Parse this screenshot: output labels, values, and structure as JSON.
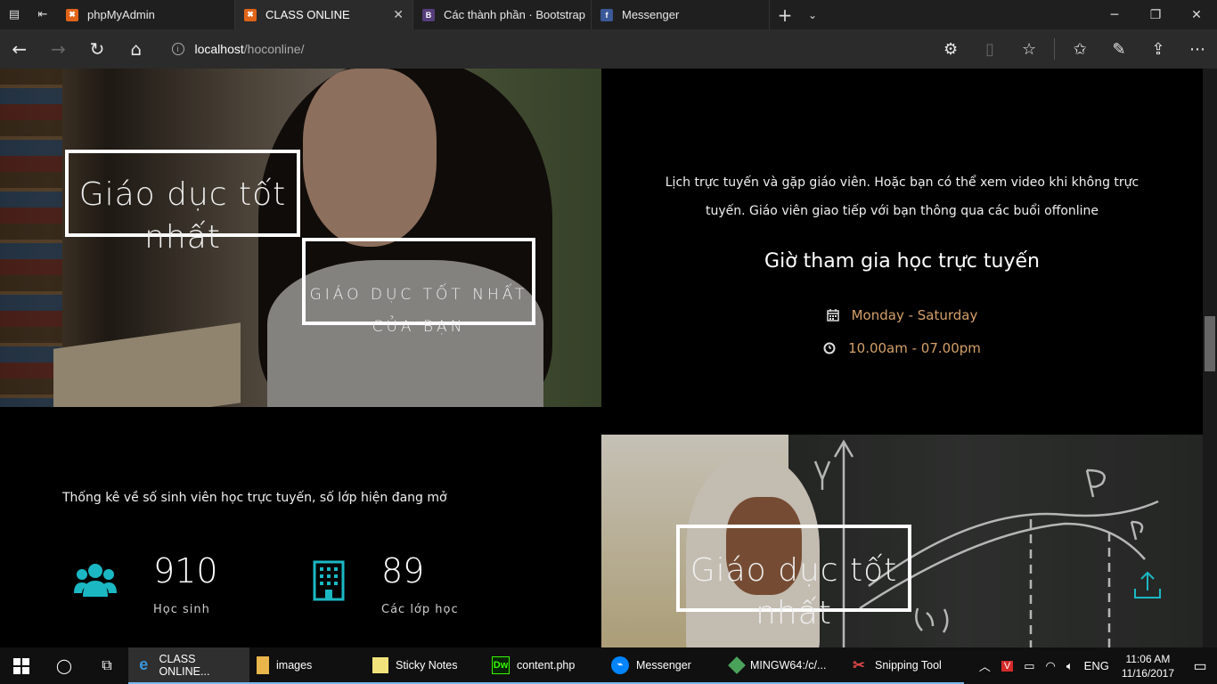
{
  "browser": {
    "tabs": [
      {
        "label": "phpMyAdmin",
        "favicon": "xampp-icon",
        "active": false
      },
      {
        "label": "CLASS ONLINE",
        "favicon": "xampp-icon",
        "active": true
      },
      {
        "label": "Các thành phần · Bootstrap",
        "favicon": "bootstrap-icon",
        "active": false
      },
      {
        "label": "Messenger",
        "favicon": "facebook-icon",
        "active": false
      }
    ],
    "address": {
      "host": "localhost",
      "path": "/hoconline/"
    },
    "colors": {
      "titlebar": "#1f1f1f",
      "toolbar": "#2b2b2b",
      "xampp": "#e06418",
      "bootstrap": "#563d7c",
      "facebook": "#3b5998"
    }
  },
  "page": {
    "hero1": {
      "frame_title": "Giáo dục tốt nhất",
      "frame_subtitle": "GIÁO DỤC TỐT NHẤT CỦA BẠN"
    },
    "info": {
      "description": "Lịch trực tuyến và gặp giáo viên. Hoặc bạn có thể xem video khi không trực tuyến. Giáo viên giao tiếp với bạn thông qua các buổi offonline",
      "heading": "Giờ tham gia học trực tuyến",
      "days": "Monday - Saturday",
      "hours": "10.00am - 07.00pm",
      "accent_color": "#d4a06a"
    },
    "stats": {
      "description": "Thống kê về số sinh viên học trực tuyến, số lớp hiện đang mở",
      "items": [
        {
          "value": "910",
          "label": "Học sinh",
          "icon": "users-icon"
        },
        {
          "value": "89",
          "label": "Các lớp học",
          "icon": "building-icon"
        }
      ],
      "icon_color": "#1bb8c4"
    },
    "hero2": {
      "frame_title": "Giáo dục tốt nhất"
    }
  },
  "taskbar": {
    "apps": [
      {
        "label": "CLASS ONLINE...",
        "icon": "edge-icon",
        "state": "active"
      },
      {
        "label": "images",
        "icon": "folder-icon",
        "state": "open"
      },
      {
        "label": "Sticky Notes",
        "icon": "sticky-notes-icon",
        "state": "open"
      },
      {
        "label": "content.php",
        "icon": "dreamweaver-icon",
        "state": "open"
      },
      {
        "label": "Messenger",
        "icon": "messenger-icon",
        "state": "open"
      },
      {
        "label": "MINGW64:/c/...",
        "icon": "git-icon",
        "state": "open"
      },
      {
        "label": "Snipping Tool",
        "icon": "snipping-tool-icon",
        "state": "open"
      }
    ],
    "language": "ENG",
    "time": "11:06 AM",
    "date": "11/16/2017"
  }
}
